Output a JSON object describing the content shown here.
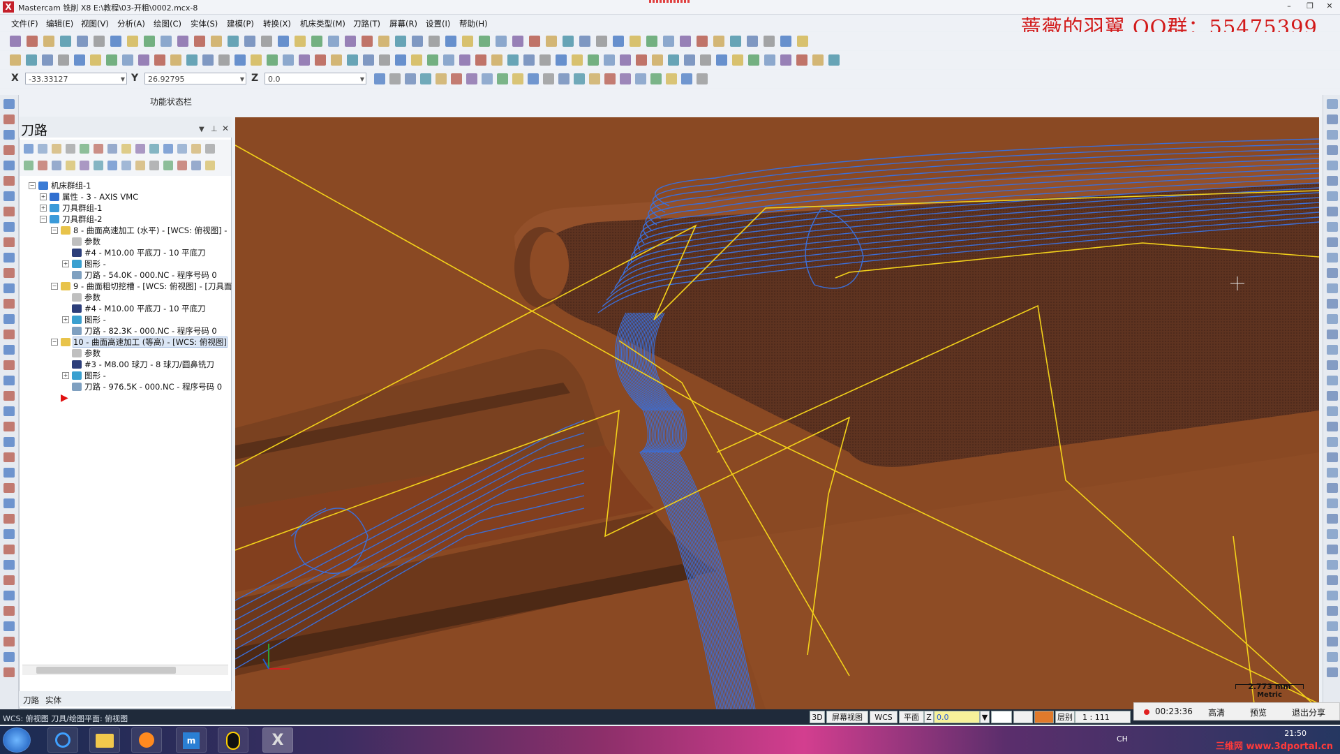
{
  "window": {
    "title": "Mastercam 铣削 X8  E:\\教程\\03-开粗\\0002.mcx-8",
    "logo": "X",
    "min": "–",
    "restore": "❐",
    "close": "✕"
  },
  "watermark": "蔷薇的羽翼 QQ群：55475399",
  "menu": [
    "文件(F)",
    "编辑(E)",
    "视图(V)",
    "分析(A)",
    "绘图(C)",
    "实体(S)",
    "建模(P)",
    "转换(X)",
    "机床类型(M)",
    "刀路(T)",
    "屏幕(R)",
    "设置(I)",
    "帮助(H)"
  ],
  "coords": {
    "x_label": "X",
    "x_value": "-33.33127",
    "y_label": "Y",
    "y_value": "26.92795",
    "z_label": "Z",
    "z_value": "0.0"
  },
  "function_status": "功能状态栏",
  "panel": {
    "title": "刀路",
    "tabs": [
      "刀路",
      "实体"
    ],
    "tree": [
      {
        "label": "机床群组-1",
        "level": 0,
        "icon": "machine-group-icon"
      },
      {
        "label": "属性 - 3 - AXIS VMC",
        "level": 1,
        "icon": "properties-icon"
      },
      {
        "label": "刀具群组-1",
        "level": 1,
        "icon": "toolgroup-icon"
      },
      {
        "label": "刀具群组-2",
        "level": 1,
        "icon": "toolgroup-icon"
      },
      {
        "label": "8 - 曲面高速加工 (水平) - [WCS: 俯视图] -",
        "level": 2,
        "icon": "folder-icon"
      },
      {
        "label": "参数",
        "level": 3,
        "icon": "params-icon"
      },
      {
        "label": "#4 - M10.00 平底刀 - 10 平底刀",
        "level": 3,
        "icon": "tool-icon"
      },
      {
        "label": "图形 -",
        "level": 3,
        "icon": "geometry-icon"
      },
      {
        "label": "刀路 - 54.0K - 000.NC - 程序号码 0",
        "level": 3,
        "icon": "toolpath-icon"
      },
      {
        "label": "9 - 曲面粗切挖槽 - [WCS: 俯视图] - [刀具面",
        "level": 2,
        "icon": "folder-icon"
      },
      {
        "label": "参数",
        "level": 3,
        "icon": "params-icon"
      },
      {
        "label": "#4 - M10.00 平底刀 - 10 平底刀",
        "level": 3,
        "icon": "tool-icon"
      },
      {
        "label": "图形 -",
        "level": 3,
        "icon": "geometry-icon"
      },
      {
        "label": "刀路 - 82.3K - 000.NC - 程序号码 0",
        "level": 3,
        "icon": "toolpath-icon"
      },
      {
        "label": "10 - 曲面高速加工 (等高) - [WCS: 俯视图]",
        "level": 2,
        "icon": "folder-icon"
      },
      {
        "label": "参数",
        "level": 3,
        "icon": "params-icon"
      },
      {
        "label": "#3 - M8.00 球刀 - 8 球刀/圆鼻铣刀",
        "level": 3,
        "icon": "tool-icon"
      },
      {
        "label": "图形 -",
        "level": 3,
        "icon": "geometry-icon"
      },
      {
        "label": "刀路 - 976.5K - 000.NC - 程序号码 0",
        "level": 3,
        "icon": "toolpath-icon"
      }
    ],
    "insert_arrow": "▶"
  },
  "viewport": {
    "scale_value": "2.773 mm",
    "scale_unit": "Metric"
  },
  "status": {
    "text": "WCS: 俯视图  刀具/绘图平面: 俯视图",
    "mode": "3D",
    "view": "屏幕视图",
    "wcs": "WCS",
    "plane": "平面",
    "z_label": "Z",
    "z_value": "0.0",
    "layer_label": "层别",
    "scale": "1 : 111"
  },
  "recorder": {
    "time": "00:23:36",
    "hd": "高清",
    "preview": "预览",
    "exit": "退出分享"
  },
  "taskbar": {
    "time": "21:50",
    "ime": "CH",
    "site": "三维网 www.3dportal.cn"
  }
}
